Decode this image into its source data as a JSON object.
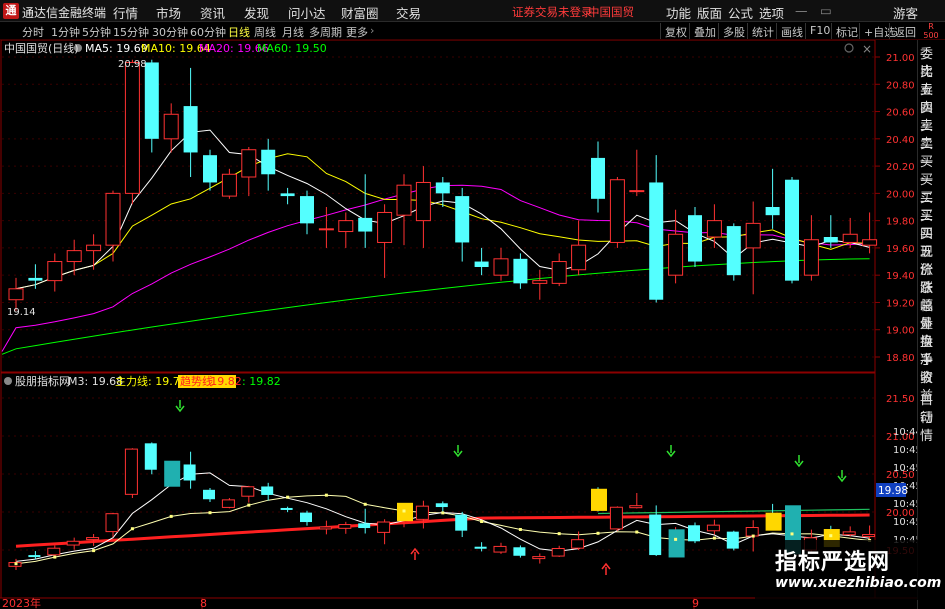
{
  "app": {
    "title": "通达信金融终端",
    "logo_glyph": "通"
  },
  "menu": [
    "行情",
    "市场",
    "资讯",
    "发现",
    "问小达",
    "财富圈",
    "交易"
  ],
  "status_warning": {
    "text1": "证券交易未登录",
    "text2": "中国国贸"
  },
  "right_menu": [
    "功能",
    "版面",
    "公式",
    "选项"
  ],
  "guest_label": "游客",
  "periods": [
    {
      "label": "分时",
      "active": false
    },
    {
      "label": "1分钟",
      "active": false
    },
    {
      "label": "5分钟",
      "active": false
    },
    {
      "label": "15分钟",
      "active": false
    },
    {
      "label": "30分钟",
      "active": false
    },
    {
      "label": "60分钟",
      "active": false
    },
    {
      "label": "日线",
      "active": true
    },
    {
      "label": "周线",
      "active": false
    },
    {
      "label": "月线",
      "active": false
    },
    {
      "label": "多周期",
      "active": false
    },
    {
      "label": "更多",
      "active": false
    }
  ],
  "toolbar_right": [
    "复权",
    "叠加",
    "多股",
    "统计",
    "画线",
    "F10",
    "标记",
    "+自选",
    "返回"
  ],
  "corner": {
    "r": "R",
    "num": "500"
  },
  "main_legend": {
    "stock": "中国国贸(日线)",
    "ma5": "MA5: 19.69",
    "ma10": "MA10: 19.64",
    "ma20": "MA20: 19.66",
    "ma60": "MA60: 19.50"
  },
  "price_axis": [
    "21.00",
    "20.80",
    "20.60",
    "20.40",
    "20.20",
    "20.00",
    "19.80",
    "19.60",
    "19.40",
    "19.20",
    "19.00",
    "18.80"
  ],
  "price_marks": {
    "high": "20.98",
    "low": "19.14"
  },
  "sub_legend": {
    "name": "股朋指标网",
    "m3": "M3: 19.68",
    "main_line": "主力线: 19.73",
    "flow_label": "趋势线",
    "flow_val": ": 19.82",
    "extra": ": 19.82"
  },
  "sub_axis": [
    "21.50",
    "21.00",
    "20.50",
    "20.00",
    "19.50"
  ],
  "sub_axis_time": [
    "10:44",
    "10:45",
    "10:45",
    "10:45",
    "10:45",
    "10:45",
    "10:45"
  ],
  "sub_current_value": "19.98",
  "date_axis": [
    "2023年",
    "8",
    "9"
  ],
  "sidebar_items": [
    {
      "label": "委比",
      "color": "#e0e0e0"
    },
    {
      "label": "卖五",
      "color": "#e0e0e0"
    },
    {
      "label": "卖四",
      "color": "#e0e0e0"
    },
    {
      "label": "卖三",
      "color": "#e0e0e0"
    },
    {
      "label": "卖二",
      "color": "#e0e0e0"
    },
    {
      "label": "卖一",
      "color": "#e0e0e0"
    },
    {
      "label": "买一",
      "color": "#e0e0e0"
    },
    {
      "label": "买二",
      "color": "#e0e0e0"
    },
    {
      "label": "买三",
      "color": "#e0e0e0"
    },
    {
      "label": "买四",
      "color": "#e0e0e0"
    },
    {
      "label": "买五",
      "color": "#e0e0e0"
    },
    {
      "label": "现价",
      "color": "#e0e0e0"
    },
    {
      "label": "涨跌",
      "color": "#e0e0e0"
    },
    {
      "label": "涨幅",
      "color": "#e0e0e0"
    },
    {
      "label": "总量",
      "color": "#e0e0e0"
    },
    {
      "label": "外盘",
      "color": "#e0e0e0"
    },
    {
      "label": "换手",
      "color": "#e0e0e0"
    },
    {
      "label": "净资",
      "color": "#e0e0e0"
    },
    {
      "label": "收益",
      "color": "#e0e0e0"
    },
    {
      "label": "自动",
      "color": "#e0e0e0"
    },
    {
      "label": "行情",
      "color": "#e0e0e0"
    }
  ],
  "watermark": {
    "title": "指标严选网",
    "url": "www.xuezhibiao.com"
  },
  "colors": {
    "up": "#ff3232",
    "down": "#54ffff",
    "ma5": "#ffffff",
    "ma10": "#ffff00",
    "ma20": "#ff00ff",
    "ma60": "#00ff00",
    "axis_text": "#ff3232",
    "frame": "#8b0000",
    "yellow_box": "#ffd700"
  },
  "candles": [
    [
      19.22,
      19.3,
      19.14,
      19.38
    ],
    [
      19.38,
      19.36,
      19.3,
      19.48
    ],
    [
      19.36,
      19.5,
      19.28,
      19.56
    ],
    [
      19.5,
      19.58,
      19.4,
      19.66
    ],
    [
      19.58,
      19.62,
      19.44,
      19.7
    ],
    [
      19.62,
      20.0,
      19.5,
      20.02
    ],
    [
      20.0,
      20.96,
      19.92,
      20.98
    ],
    [
      20.96,
      20.4,
      20.3,
      20.98
    ],
    [
      20.4,
      20.58,
      20.3,
      20.66
    ],
    [
      20.64,
      20.3,
      20.12,
      20.92
    ],
    [
      20.28,
      20.08,
      20.02,
      20.32
    ],
    [
      19.98,
      20.14,
      19.96,
      20.18
    ],
    [
      20.12,
      20.32,
      19.98,
      20.34
    ],
    [
      20.32,
      20.14,
      20.02,
      20.4
    ],
    [
      20.0,
      19.98,
      19.92,
      20.04
    ],
    [
      19.98,
      19.78,
      19.7,
      20.02
    ],
    [
      19.74,
      19.74,
      19.6,
      19.9
    ],
    [
      19.72,
      19.8,
      19.6,
      19.86
    ],
    [
      19.82,
      19.72,
      19.6,
      20.14
    ],
    [
      19.64,
      19.86,
      19.38,
      19.92
    ],
    [
      19.84,
      20.06,
      19.62,
      20.14
    ],
    [
      19.8,
      20.08,
      19.6,
      20.2
    ],
    [
      20.08,
      20.0,
      19.9,
      20.12
    ],
    [
      19.98,
      19.64,
      19.5,
      20.04
    ],
    [
      19.5,
      19.46,
      19.4,
      19.6
    ],
    [
      19.4,
      19.52,
      19.36,
      19.6
    ],
    [
      19.52,
      19.34,
      19.3,
      19.56
    ],
    [
      19.34,
      19.36,
      19.22,
      19.44
    ],
    [
      19.34,
      19.5,
      19.32,
      19.56
    ],
    [
      19.44,
      19.62,
      19.4,
      19.8
    ],
    [
      20.26,
      19.96,
      19.86,
      20.38
    ],
    [
      19.64,
      20.1,
      19.6,
      20.12
    ],
    [
      20.02,
      20.02,
      19.98,
      20.32
    ],
    [
      20.08,
      19.22,
      19.2,
      20.28
    ],
    [
      19.4,
      19.7,
      19.34,
      19.88
    ],
    [
      19.84,
      19.5,
      19.46,
      19.9
    ],
    [
      19.68,
      19.8,
      19.6,
      19.92
    ],
    [
      19.76,
      19.4,
      19.36,
      19.78
    ],
    [
      19.6,
      19.78,
      19.26,
      19.94
    ],
    [
      19.9,
      19.84,
      19.74,
      20.18
    ],
    [
      20.1,
      19.36,
      19.34,
      20.12
    ],
    [
      19.4,
      19.66,
      19.36,
      19.84
    ],
    [
      19.68,
      19.64,
      19.6,
      19.84
    ],
    [
      19.64,
      19.7,
      19.6,
      19.82
    ],
    [
      19.62,
      19.66,
      19.56,
      19.86
    ]
  ]
}
